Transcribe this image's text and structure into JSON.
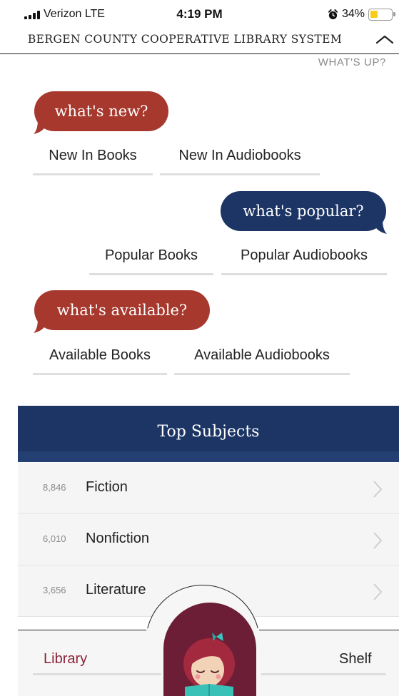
{
  "status_bar": {
    "carrier": "Verizon  LTE",
    "time": "4:19 PM",
    "battery_percent": "34%",
    "battery_level": 0.34,
    "icons": [
      "signal-icon",
      "alarm-icon",
      "battery-icon"
    ]
  },
  "header": {
    "library_name": "BERGEN COUNTY COOPERATIVE LIBRARY SYSTEM",
    "collapse_icon": "chevron-up-icon",
    "whats_up": "WHAT'S UP?"
  },
  "sections": {
    "new": {
      "bubble": "what's new?",
      "links": [
        "New In Books",
        "New In Audiobooks"
      ]
    },
    "popular": {
      "bubble": "what's popular?",
      "links": [
        "Popular Books",
        "Popular Audiobooks"
      ]
    },
    "available": {
      "bubble": "what's available?",
      "links": [
        "Available Books",
        "Available Audiobooks"
      ]
    }
  },
  "top_subjects": {
    "title": "Top Subjects",
    "items": [
      {
        "count": "8,846",
        "label": "Fiction"
      },
      {
        "count": "6,010",
        "label": "Nonfiction"
      },
      {
        "count": "3,656",
        "label": "Literature"
      }
    ]
  },
  "bottom_nav": {
    "library": "Library",
    "shelf": "Shelf",
    "logo_icon": "libby-reader-icon"
  },
  "colors": {
    "red_bubble": "#a6382d",
    "blue_bubble": "#1c3565",
    "library_tab": "#8a2236",
    "logo_background": "#6b1e36",
    "battery": "#f6cd1d"
  }
}
